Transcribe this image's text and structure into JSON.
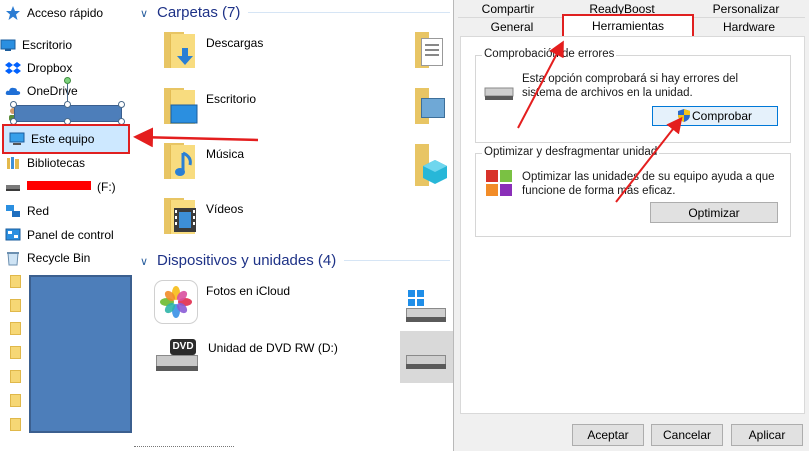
{
  "nav": {
    "quick_access": "Acceso rápido",
    "items": [
      {
        "label": "Escritorio",
        "icon": "desktop-icon"
      },
      {
        "label": "Dropbox",
        "icon": "dropbox-icon"
      },
      {
        "label": "OneDrive",
        "icon": "cloud-icon"
      },
      {
        "label": "",
        "icon": "user-icon"
      },
      {
        "label": "Este equipo",
        "icon": "computer-icon"
      },
      {
        "label": "Bibliotecas",
        "icon": "library-icon"
      },
      {
        "label": "(F:)",
        "icon": "drive-icon"
      },
      {
        "label": "Red",
        "icon": "network-icon"
      },
      {
        "label": "Panel de control",
        "icon": "control-panel-icon"
      },
      {
        "label": "Recycle Bin",
        "icon": "recycle-bin-icon"
      }
    ]
  },
  "content": {
    "folders_header": "Carpetas (7)",
    "folders": [
      "Descargas",
      "Escritorio",
      "Música",
      "Vídeos"
    ],
    "devices_header": "Dispositivos y unidades (4)",
    "devices": [
      "Fotos en iCloud",
      "Unidad de DVD RW (D:)"
    ]
  },
  "dialog": {
    "tabs_row1": [
      "Compartir",
      "ReadyBoost",
      "Personalizar"
    ],
    "tabs_row2": [
      "General",
      "Herramientas",
      "Hardware"
    ],
    "error_group_title": "Comprobación de errores",
    "error_text_1": "Esta opción comprobará si hay errores del",
    "error_text_2": "sistema de archivos en la unidad.",
    "check_button": "Comprobar",
    "optimize_group_title": "Optimizar y desfragmentar unidad",
    "optimize_text_1": "Optimizar las unidades de su equipo ayuda a que",
    "optimize_text_2": "funcione de forma más eficaz.",
    "optimize_button": "Optimizar",
    "ok_button": "Aceptar",
    "cancel_button": "Cancelar",
    "apply_button": "Aplicar"
  },
  "colors": {
    "annotation_red": "#e41e1e",
    "selection_blue": "#cde8ff",
    "header_blue": "#1e3287"
  }
}
